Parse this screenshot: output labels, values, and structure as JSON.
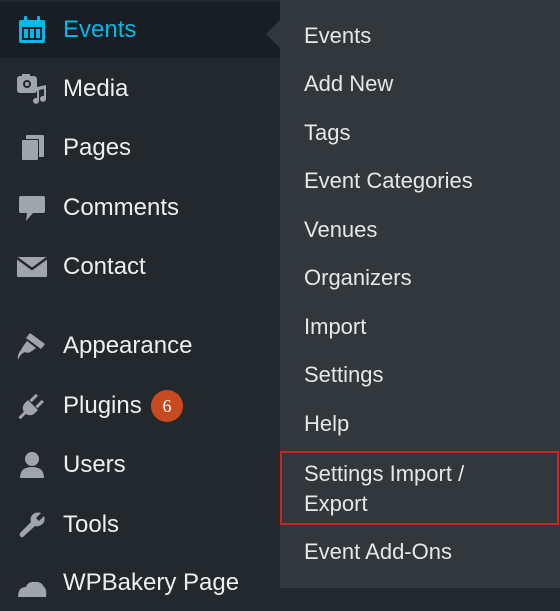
{
  "sidebar": {
    "items": [
      {
        "label": "Events",
        "icon": "calendar-icon",
        "active": true
      },
      {
        "label": "Media",
        "icon": "media-icon"
      },
      {
        "label": "Pages",
        "icon": "pages-icon"
      },
      {
        "label": "Comments",
        "icon": "comment-icon"
      },
      {
        "label": "Contact",
        "icon": "envelope-icon"
      },
      {
        "label": "Appearance",
        "icon": "paintbrush-icon"
      },
      {
        "label": "Plugins",
        "icon": "plug-icon",
        "badge": "6"
      },
      {
        "label": "Users",
        "icon": "user-icon"
      },
      {
        "label": "Tools",
        "icon": "wrench-icon"
      },
      {
        "label": "WPBakery Page",
        "icon": "wpbakery-icon"
      }
    ]
  },
  "submenu": {
    "items": [
      {
        "label": "Events"
      },
      {
        "label": "Add New"
      },
      {
        "label": "Tags"
      },
      {
        "label": "Event Categories"
      },
      {
        "label": "Venues"
      },
      {
        "label": "Organizers"
      },
      {
        "label": "Import"
      },
      {
        "label": "Settings"
      },
      {
        "label": "Help"
      },
      {
        "label": "Settings Import / Export",
        "highlighted": true
      },
      {
        "label": "Event Add-Ons"
      }
    ]
  },
  "colors": {
    "sidebar_bg": "#23282d",
    "submenu_bg": "#32373c",
    "active_text": "#00b9eb",
    "badge_bg": "#ca4a1f",
    "highlight_border": "#c9242b"
  }
}
